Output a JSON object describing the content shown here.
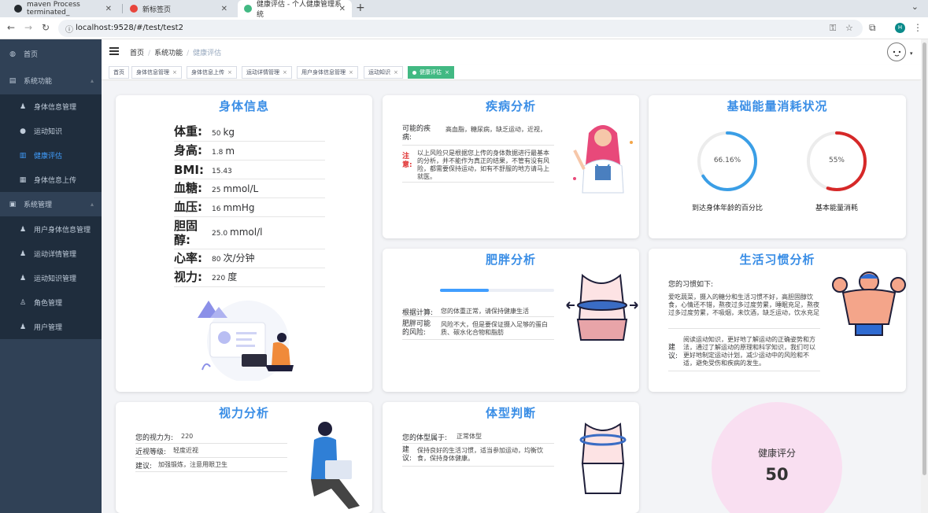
{
  "browser": {
    "tabs": [
      {
        "title": "maven Process terminated_",
        "icon": "github-icon"
      },
      {
        "title": "新标签页",
        "icon": "chrome-icon"
      },
      {
        "title": "健康评估 - 个人健康管理系统",
        "icon": "vue-icon"
      }
    ],
    "url": "localhost:9528/#/test/test2",
    "profile_initial": "H"
  },
  "sidebar": {
    "items": [
      {
        "label": "首页",
        "icon": "dashboard-icon"
      },
      {
        "label": "系统功能",
        "icon": "document-icon"
      },
      {
        "label": "身体信息管理",
        "icon": "user-icon"
      },
      {
        "label": "运动知识",
        "icon": "bulb-icon"
      },
      {
        "label": "健康评估",
        "icon": "chart-icon"
      },
      {
        "label": "身体信息上传",
        "icon": "upload-icon"
      },
      {
        "label": "系统管理",
        "icon": "folder-icon"
      },
      {
        "label": "用户身体信息管理",
        "icon": "user-icon"
      },
      {
        "label": "运动详情管理",
        "icon": "user-icon"
      },
      {
        "label": "运动知识管理",
        "icon": "user-icon"
      },
      {
        "label": "角色管理",
        "icon": "person-icon"
      },
      {
        "label": "用户管理",
        "icon": "user-icon"
      }
    ]
  },
  "breadcrumb": [
    "首页",
    "系统功能",
    "健康评估"
  ],
  "tags": [
    "首页",
    "身体信息管理",
    "身体信息上传",
    "运动详情管理",
    "用户身体信息管理",
    "运动知识",
    "健康评估"
  ],
  "body_info": {
    "title": "身体信息",
    "rows": [
      {
        "label": "体重:",
        "value": "50",
        "unit": "kg"
      },
      {
        "label": "身高:",
        "value": "1.8",
        "unit": "m"
      },
      {
        "label": "BMI:",
        "value": "15.43",
        "unit": ""
      },
      {
        "label": "血糖:",
        "value": "25",
        "unit": "mmol/L"
      },
      {
        "label": "血压:",
        "value": "16",
        "unit": "mmHg"
      },
      {
        "label": "胆固醇:",
        "value": "25.0",
        "unit": "mmol/l"
      },
      {
        "label": "心率:",
        "value": "80",
        "unit": "次/分钟"
      },
      {
        "label": "视力:",
        "value": "220",
        "unit": "度"
      }
    ]
  },
  "disease": {
    "title": "疾病分析",
    "possible_label": "可能的疾病:",
    "possible_value": "高血脂，糖尿病，缺乏运动，近视，",
    "note_label": "注意:",
    "note_value": "以上风险只是根据您上传的身体数据进行最基本的分析，并不能作为真正的结果，不管有没有风险，都需要保持运动，如有不舒服的地方请马上就医。"
  },
  "energy": {
    "title": "基础能量消耗状况",
    "gauge1": {
      "percent": 66.16,
      "text": "66.16%",
      "label": "到达身体年龄的百分比",
      "color": "#3a9ee6"
    },
    "gauge2": {
      "percent": 55,
      "text": "55%",
      "label": "基本能量消耗",
      "color": "#d62828"
    }
  },
  "obesity": {
    "title": "肥胖分析",
    "progress": 0.43,
    "calc_label": "根据计算:",
    "calc_value": "您的体重正常，请保持健康生活",
    "risk_label": "肥胖可能的风险:",
    "risk_value": "风险不大，但是要保证摄入足够的蛋白质、碳水化合物和脂肪"
  },
  "habit": {
    "title": "生活习惯分析",
    "intro": "您的习惯如下:",
    "habits": "爱吃蔬菜，摄入的糖分和生活习惯不好，高胆固醇饮食，心情还不错，熬夜过多过度劳累，睡眠充足，熬夜过多过度劳累，不吸烟，未饮酒，缺乏运动，饮水充足",
    "advice_label": "建议:",
    "advice": "阅读运动知识，更好地了解运动的正确姿势和方法，通过了解运动的原理和科学知识，我们可以更好地制定运动计划，减少运动中的风险和不适，避免受伤和疾病的发生。"
  },
  "vision": {
    "title": "视力分析",
    "rows": [
      {
        "label": "您的视力为:",
        "value": "220"
      },
      {
        "label": "近视等级:",
        "value": "轻度近视"
      },
      {
        "label": "建议:",
        "value": "加强锻炼，注意用眼卫生"
      }
    ]
  },
  "body_type": {
    "title": "体型判断",
    "type_label": "您的体型属于:",
    "type_value": "正常体型",
    "advice_label": "建议:",
    "advice_value": "保持良好的生活习惯，适当参加运动，均衡饮食，保持身体健康。"
  },
  "score": {
    "label": "健康评分",
    "value": "50"
  }
}
